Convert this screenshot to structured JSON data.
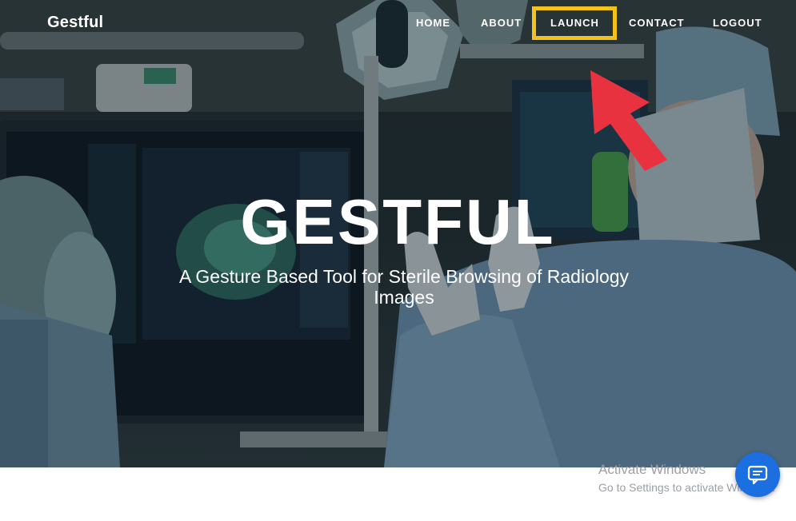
{
  "nav": {
    "brand": "Gestful",
    "items": [
      {
        "label": "HOME"
      },
      {
        "label": "ABOUT"
      },
      {
        "label": "LAUNCH"
      },
      {
        "label": "CONTACT"
      },
      {
        "label": "LOGOUT"
      }
    ]
  },
  "hero": {
    "title": "GESTFUL",
    "subtitle": "A Gesture Based Tool for Sterile Browsing of Radiology Images"
  },
  "watermark": {
    "title": "Activate Windows",
    "subtitle": "Go to Settings to activate Windows."
  },
  "annotation": {
    "highlight_color": "#f3c31b",
    "arrow_color": "#e8323f"
  },
  "chat": {
    "icon": "chat-icon",
    "color": "#1b6fe0"
  }
}
